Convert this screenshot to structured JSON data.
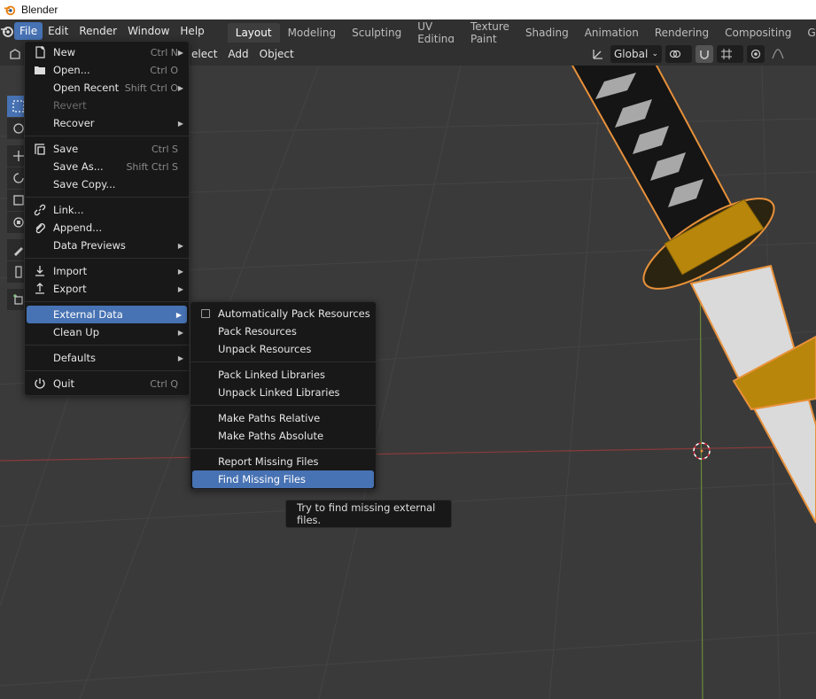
{
  "window": {
    "title": "Blender"
  },
  "topbar": {
    "menus": [
      "File",
      "Edit",
      "Render",
      "Window",
      "Help"
    ],
    "workspaces": [
      "Layout",
      "Modeling",
      "Sculpting",
      "UV Editing",
      "Texture Paint",
      "Shading",
      "Animation",
      "Rendering",
      "Compositing",
      "Geome"
    ],
    "active_workspace": "Layout"
  },
  "viewport_header": {
    "menus": [
      "elect",
      "Add",
      "Object"
    ],
    "transform_orientation": "Global"
  },
  "file_menu": {
    "items": [
      {
        "label": "New",
        "shortcut": "Ctrl N",
        "submenu": true,
        "icon": "new-file-icon"
      },
      {
        "label": "Open...",
        "shortcut": "Ctrl O",
        "icon": "folder-icon"
      },
      {
        "label": "Open Recent",
        "shortcut": "Shift Ctrl O",
        "submenu": true
      },
      {
        "label": "Revert",
        "disabled": true
      },
      {
        "label": "Recover",
        "submenu": true
      },
      {
        "label": "Save",
        "shortcut": "Ctrl S",
        "icon": "save-icon"
      },
      {
        "label": "Save As...",
        "shortcut": "Shift Ctrl S"
      },
      {
        "label": "Save Copy..."
      },
      {
        "label": "Link...",
        "icon": "link-icon"
      },
      {
        "label": "Append...",
        "icon": "append-icon"
      },
      {
        "label": "Data Previews",
        "submenu": true
      },
      {
        "label": "Import",
        "submenu": true,
        "icon": "import-icon"
      },
      {
        "label": "Export",
        "submenu": true,
        "icon": "export-icon"
      },
      {
        "label": "External Data",
        "submenu": true,
        "highlighted": true
      },
      {
        "label": "Clean Up",
        "submenu": true
      },
      {
        "label": "Defaults",
        "submenu": true
      },
      {
        "label": "Quit",
        "shortcut": "Ctrl Q",
        "icon": "power-icon"
      }
    ]
  },
  "external_data_menu": {
    "items": [
      {
        "label": "Automatically Pack Resources",
        "checkbox": true,
        "checked": false
      },
      {
        "label": "Pack Resources"
      },
      {
        "label": "Unpack Resources"
      },
      {
        "label": "Pack Linked Libraries"
      },
      {
        "label": "Unpack Linked Libraries"
      },
      {
        "label": "Make Paths Relative"
      },
      {
        "label": "Make Paths Absolute"
      },
      {
        "label": "Report Missing Files"
      },
      {
        "label": "Find Missing Files",
        "highlighted": true
      }
    ]
  },
  "tooltip": {
    "text": "Try to find missing external files."
  },
  "colors": {
    "accent": "#4772b3",
    "menu_bg": "#181818",
    "header_bg": "#303030",
    "viewport_bg": "#3a3a3a"
  }
}
